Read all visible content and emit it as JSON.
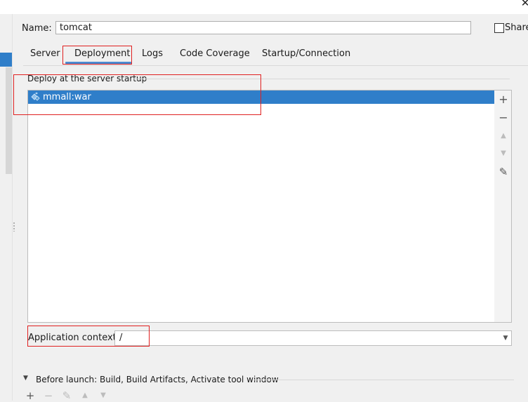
{
  "window": {
    "close_glyph": "✕"
  },
  "name": {
    "label": "Name:",
    "value": "tomcat"
  },
  "share": {
    "label": "Share",
    "checked": false
  },
  "tabs": [
    {
      "label": "Server",
      "selected": false
    },
    {
      "label": "Deployment",
      "selected": true
    },
    {
      "label": "Logs",
      "selected": false
    },
    {
      "label": "Code Coverage",
      "selected": false
    },
    {
      "label": "Startup/Connection",
      "selected": false
    }
  ],
  "deploy": {
    "group_label": "Deploy at the server startup",
    "items": [
      {
        "label": "mmall:war",
        "icon": "artifact-icon",
        "selected": true
      }
    ],
    "toolbar": [
      {
        "name": "add",
        "glyph": "+",
        "enabled": true
      },
      {
        "name": "remove",
        "glyph": "−",
        "enabled": true
      },
      {
        "name": "move-up",
        "glyph": "▲",
        "enabled": false
      },
      {
        "name": "move-down",
        "glyph": "▼",
        "enabled": false
      },
      {
        "name": "edit",
        "glyph": "✎",
        "enabled": true
      }
    ]
  },
  "context": {
    "label": "Application context:",
    "value": "/"
  },
  "before_launch": {
    "label": "Before launch: Build, Build Artifacts, Activate tool window",
    "toolbar": [
      {
        "name": "add",
        "glyph": "+",
        "enabled": true
      },
      {
        "name": "remove",
        "glyph": "−",
        "enabled": false
      },
      {
        "name": "edit",
        "glyph": "✎",
        "enabled": false
      },
      {
        "name": "move-up",
        "glyph": "▲",
        "enabled": false
      },
      {
        "name": "move-down",
        "glyph": "▼",
        "enabled": false
      }
    ]
  },
  "colors": {
    "selection": "#2f7ec9",
    "annotation_red": "#e02020",
    "tab_underline": "#4b8bd0"
  }
}
